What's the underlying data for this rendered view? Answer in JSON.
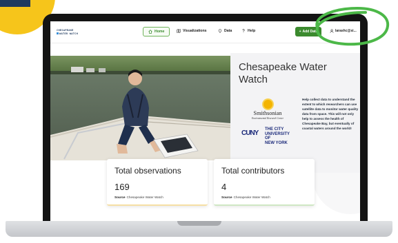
{
  "brand": {
    "logo_line1": "CHESAPEAKE",
    "logo_line2": "WATER WATCH"
  },
  "nav": {
    "home_label": "Home",
    "visualizations_label": "Visualizations",
    "data_label": "Data",
    "help_label": "Help",
    "add_data_label": "Add Data",
    "user_label": "larashc@si..."
  },
  "hero": {
    "title": "Chesapeake Water Watch",
    "description": "Help collect data to understand the extent to which researchers can use satellite data to monitor water quality data from space. This will not only help to assess the health of Chesapeake Bay, but eventually of coastal waters around the world!",
    "photo_alt": "Student on a boat holding a phone and a white data box on a river"
  },
  "partners": {
    "smithsonian_name": "Smithsonian",
    "smithsonian_sub": "Environmental Research Center",
    "cuny_mark": "CUNY",
    "cuny_line1": "THE CITY",
    "cuny_line2": "UNIVERSITY",
    "cuny_line3": "OF",
    "cuny_line4": "NEW YORK"
  },
  "stats": [
    {
      "label": "Total observations",
      "value": "169",
      "source_label": "Source",
      "source_value": "Chesapeake Water Watch"
    },
    {
      "label": "Total contributors",
      "value": "4",
      "source_label": "Source",
      "source_value": "Chesapeake Water Watch"
    }
  ],
  "colors": {
    "accent_green": "#3b8a2e",
    "brand_navy": "#1f3a5f",
    "yellow": "#f6c51b",
    "annotation_green": "#4cb848"
  },
  "icons": [
    "home-icon",
    "map-icon",
    "pin-icon",
    "help-icon",
    "plus-icon",
    "user-icon"
  ]
}
